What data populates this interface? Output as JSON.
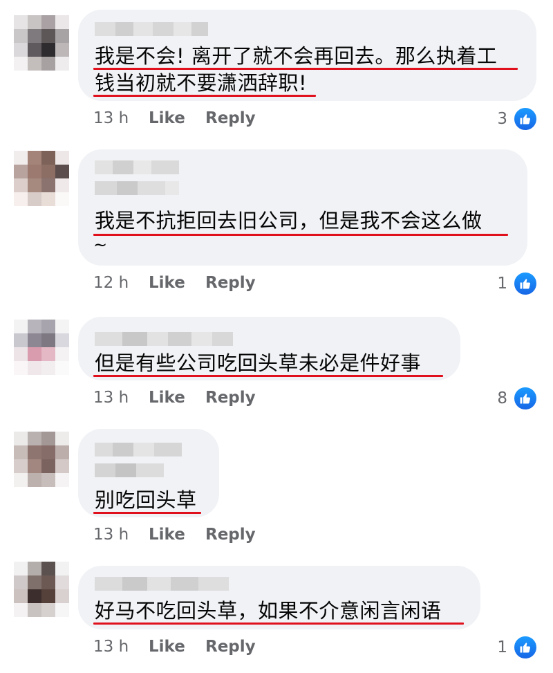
{
  "comments": [
    {
      "text_lines": [
        "我是不会! 离开了就不会再回去。那么执着工",
        "钱当初就不要潇洒辞职!"
      ],
      "time": "13 h",
      "like_label": "Like",
      "reply_label": "Reply",
      "reaction_count": "3",
      "avatar_colors": [
        "#e6e4e4",
        "#c8c4c4",
        "#a9a1a3",
        "#ebe7e8",
        "#c9c7c8",
        "#7e7a7d",
        "#5d5758",
        "#a7a2a4",
        "#dad8da",
        "#5e5a5e",
        "#2f2c2f",
        "#bdb7b8",
        "#f3f1f1",
        "#c3bdbc",
        "#a7a1a2",
        "#eeeced"
      ]
    },
    {
      "text_lines": [
        "我是不抗拒回去旧公司，但是我不会这么做"
      ],
      "extra": "~",
      "time": "12 h",
      "like_label": "Like",
      "reply_label": "Reply",
      "reaction_count": "1",
      "avatar_colors": [
        "#f2eded",
        "#a48378",
        "#7c6258",
        "#ede8e7",
        "#b8a39e",
        "#9c7a70",
        "#8c6e64",
        "#5a4d4c",
        "#dccfcb",
        "#a78a7f",
        "#8b7470",
        "#efe9e9",
        "#f6efed",
        "#d8ccc8",
        "#e9ddd8",
        "#fbf8f8"
      ]
    },
    {
      "text_lines": [
        "但是有些公司吃回头草未必是件好事"
      ],
      "time": "13 h",
      "like_label": "Like",
      "reply_label": "Reply",
      "reaction_count": "8",
      "avatar_colors": [
        "#f3f3f4",
        "#b8b4bc",
        "#a7a4ad",
        "#f4f4f5",
        "#c9c8cf",
        "#8c8793",
        "#7d7882",
        "#d9d8de",
        "#ece4e7",
        "#d99bae",
        "#e4b8c4",
        "#f4f2f3",
        "#faf6f7",
        "#efe7ea",
        "#f2eef0",
        "#fbfafa"
      ]
    },
    {
      "text_lines": [
        "别吃回头草"
      ],
      "time": "13 h",
      "like_label": "Like",
      "reply_label": "Reply",
      "reaction_count": "",
      "avatar_colors": [
        "#ece9e9",
        "#b9b1b0",
        "#a39896",
        "#eeebeb",
        "#c8bcb9",
        "#8e7570",
        "#866d69",
        "#bcaeab",
        "#d7cdcb",
        "#a28781",
        "#7b635f",
        "#d4c9c7",
        "#f3f0f0",
        "#bdb1ae",
        "#c7bdbb",
        "#f5f3f3"
      ]
    },
    {
      "text_lines": [
        "好马不吃回头草，如果不介意闲言闲语"
      ],
      "time": "13 h",
      "like_label": "Like",
      "reply_label": "Reply",
      "reaction_count": "1",
      "avatar_colors": [
        "#f2f1f1",
        "#b3aeac",
        "#5b524f",
        "#f3f2f2",
        "#cfcac9",
        "#7f706b",
        "#6c5954",
        "#e1dcdb",
        "#cbc1bf",
        "#3c2e2c",
        "#56403a",
        "#d8d1cf",
        "#f4f2f2",
        "#c8c2c0",
        "#d6d0ce",
        "#f7f6f6"
      ]
    }
  ]
}
